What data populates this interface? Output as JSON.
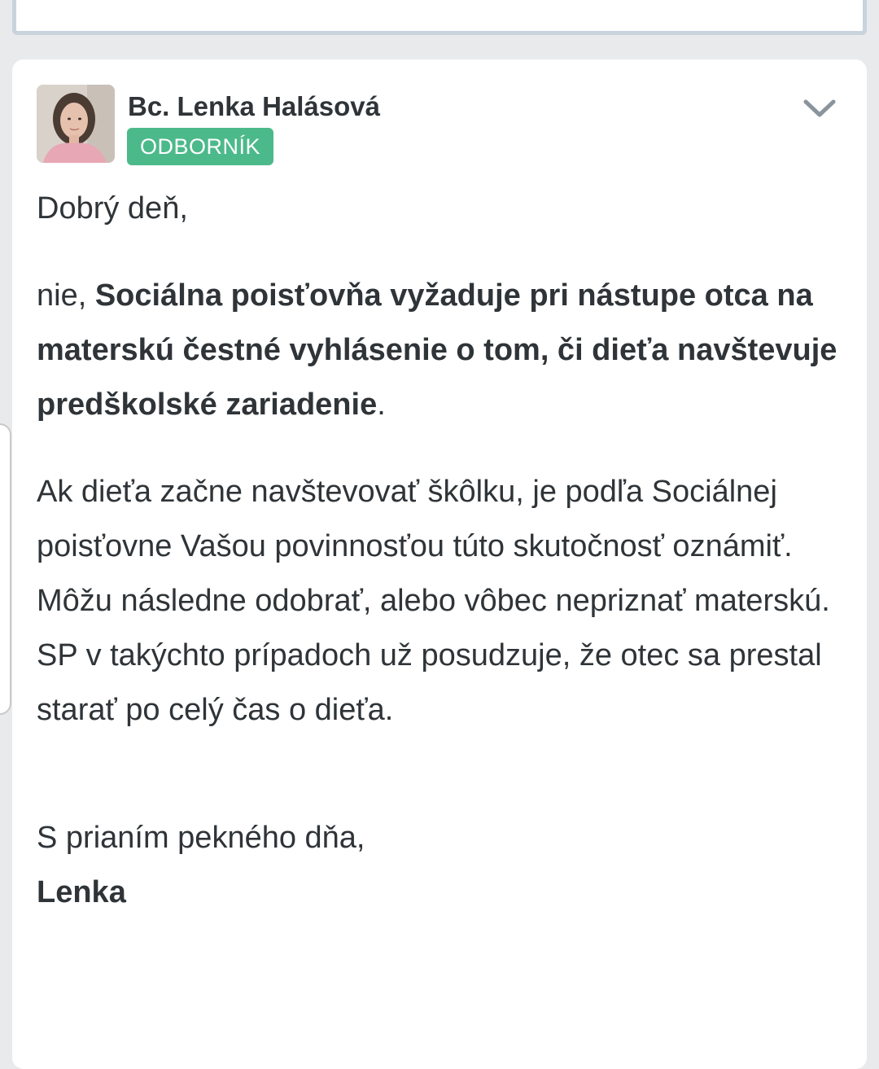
{
  "post": {
    "author_name": "Bc. Lenka Halásová",
    "role_badge": "ODBORNÍK",
    "greeting": "Dobrý deň,",
    "para1_prefix": "nie, ",
    "para1_bold": "Sociálna poisťovňa vyžaduje pri nástupe otca na materskú čestné vyhlásenie o tom, či dieťa navštevuje predškolské zariadenie",
    "para1_suffix": ".",
    "para2": "Ak dieťa začne navštevovať škôlku, je podľa Sociálnej poisťovne Vašou povinnosťou túto skutočnosť oznámiť. Môžu následne odobrať, alebo vôbec nepriznať materskú. SP v takýchto prípadoch už posudzuje, že otec sa prestal starať po celý čas o dieťa.",
    "closing": "S prianím pekného dňa,",
    "signature": "Lenka"
  },
  "icons": {
    "expand": "chevron-down-icon",
    "avatar": "avatar"
  },
  "colors": {
    "badge": "#4cb98a",
    "text": "#2f3438",
    "background": "#e9eaec"
  }
}
